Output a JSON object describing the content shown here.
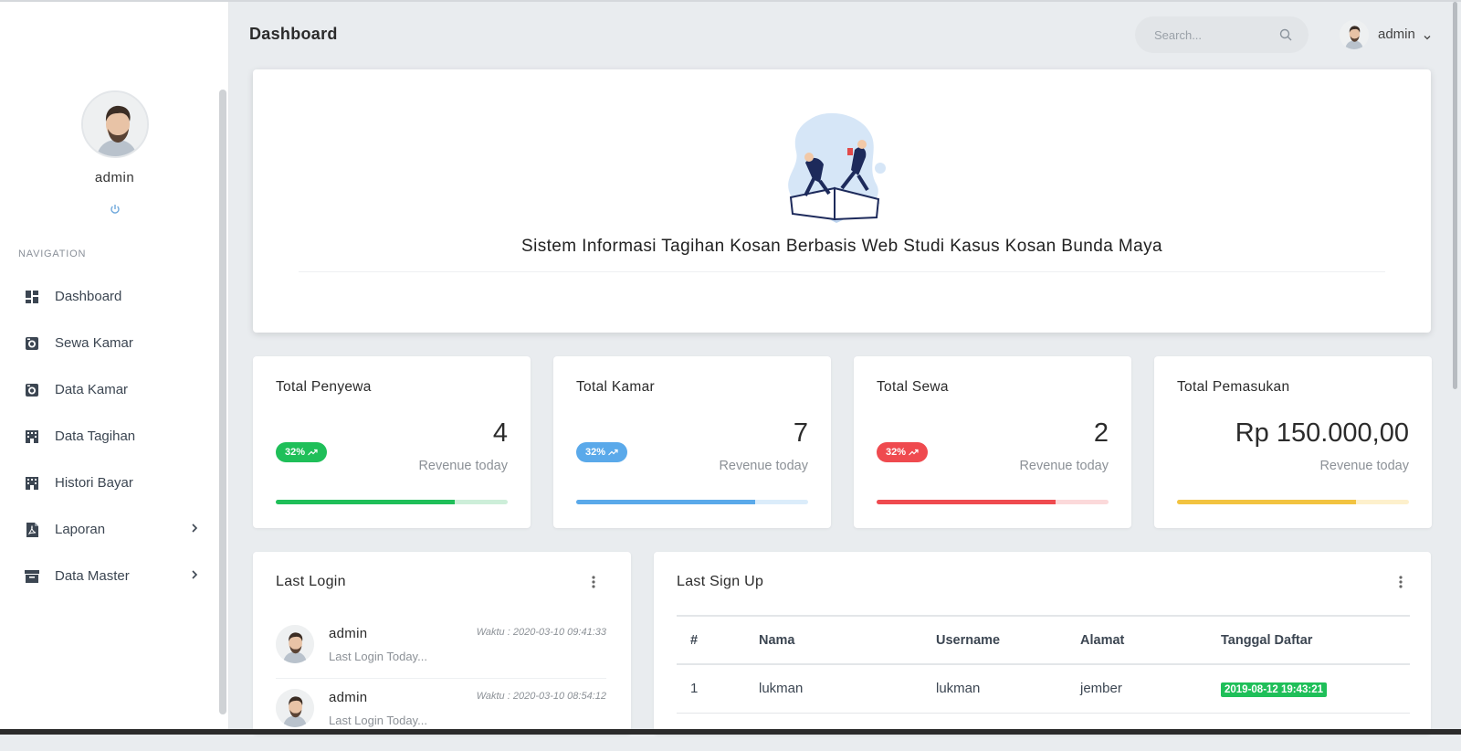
{
  "page": {
    "title": "Dashboard"
  },
  "header": {
    "search_placeholder": "Search...",
    "user_name": "admin"
  },
  "sidebar": {
    "profile_name": "admin",
    "nav_heading": "NAVIGATION",
    "items": [
      {
        "label": "Dashboard",
        "icon": "dashboard-icon"
      },
      {
        "label": "Sewa Kamar",
        "icon": "camera-icon"
      },
      {
        "label": "Data Kamar",
        "icon": "camera-icon"
      },
      {
        "label": "Data Tagihan",
        "icon": "building-icon"
      },
      {
        "label": "Histori Bayar",
        "icon": "building-icon"
      },
      {
        "label": "Laporan",
        "icon": "file-pdf-icon",
        "has_submenu": true
      },
      {
        "label": "Data Master",
        "icon": "archive-icon",
        "has_submenu": true
      }
    ]
  },
  "hero": {
    "title": "Sistem Informasi Tagihan Kosan Berbasis Web Studi Kasus Kosan Bunda Maya"
  },
  "stats": [
    {
      "title": "Total Penyewa",
      "value": "4",
      "subtitle": "Revenue today",
      "badge": "32%",
      "color": "#1fbf59",
      "track": "#cdeed9",
      "progress": 0.77
    },
    {
      "title": "Total Kamar",
      "value": "7",
      "subtitle": "Revenue today",
      "badge": "32%",
      "color": "#5aa9ea",
      "track": "#dbecfa",
      "progress": 0.77
    },
    {
      "title": "Total Sewa",
      "value": "2",
      "subtitle": "Revenue today",
      "badge": "32%",
      "color": "#ef4a4f",
      "track": "#fbd9da",
      "progress": 0.77
    },
    {
      "title": "Total Pemasukan",
      "value": "Rp 150.000,00",
      "subtitle": "Revenue today",
      "badge": "",
      "color": "#f2c340",
      "track": "#fdf0cc",
      "progress": 0.77
    }
  ],
  "last_login": {
    "title": "Last Login",
    "items": [
      {
        "name": "admin",
        "time": "Waktu : 2020-03-10 09:41:33",
        "desc": "Last Login Today..."
      },
      {
        "name": "admin",
        "time": "Waktu : 2020-03-10 08:54:12",
        "desc": "Last Login Today..."
      }
    ]
  },
  "last_signup": {
    "title": "Last Sign Up",
    "columns": [
      "#",
      "Nama",
      "Username",
      "Alamat",
      "Tanggal Daftar"
    ],
    "rows": [
      {
        "no": "1",
        "nama": "lukman",
        "username": "lukman",
        "alamat": "jember",
        "tanggal": "2019-08-12 19:43:21"
      }
    ]
  }
}
